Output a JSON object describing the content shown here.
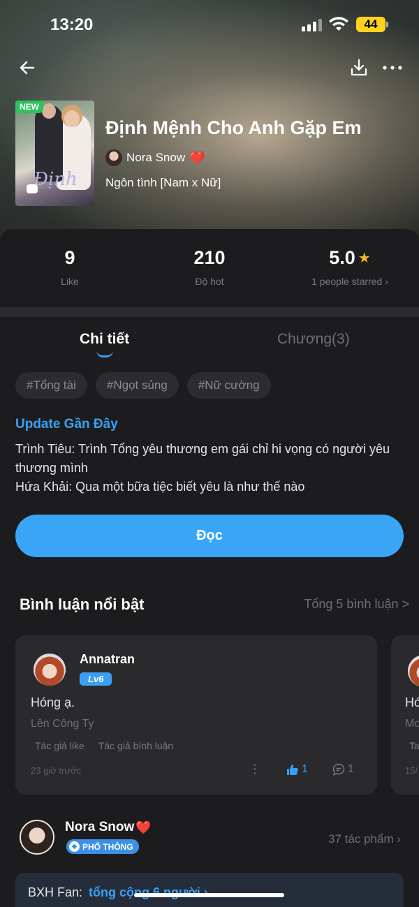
{
  "status": {
    "time": "13:20",
    "battery": "44"
  },
  "book": {
    "badge": "NEW",
    "cover_art_text": "Định",
    "title": "Định Mệnh Cho Anh Gặp Em",
    "author": "Nora Snow",
    "author_suffix": "❤️",
    "genre": "Ngôn tình [Nam x Nữ]"
  },
  "stats": {
    "likes": {
      "value": "9",
      "label": "Like"
    },
    "hot": {
      "value": "210",
      "label": "Độ hot"
    },
    "rating": {
      "value": "5.0",
      "label": "1 people starred ›"
    }
  },
  "tabs": {
    "detail": "Chi tiết",
    "chapters": "Chương(3)"
  },
  "tags": [
    "#Tổng tài",
    "#Ngọt sủng",
    "#Nữ cường"
  ],
  "update": {
    "title": "Update Gần Đây",
    "line1": "Trình Tiêu: Trình Tổng yêu thương em gái chỉ hi vọng có người yêu thương mình",
    "line2": "Hứa Khải: Qua một bữa tiệc biết yêu là như thế nào"
  },
  "read_button": "Đọc",
  "comments": {
    "title": "Bình luận nổi bật",
    "total": "Tổng 5 bình luận >",
    "items": [
      {
        "user": "Annatran",
        "level": "Lv6",
        "text": "Hóng ạ.",
        "chapter": "Lên Công Ty",
        "chip_like": "Tác giả like",
        "chip_comment": "Tác giả bình luận",
        "time": "23 giờ trước",
        "likes": "1",
        "replies": "1"
      }
    ],
    "peek": {
      "t1": "Hó",
      "t2": "Mo",
      "t3": "Ta",
      "t4": "15/"
    }
  },
  "author_block": {
    "name": "Nora Snow",
    "heart": "❤️",
    "badge": "PHỔ THÔNG",
    "works": "37 tác phẩm ›"
  },
  "fan": {
    "label": "BXH Fan:",
    "link": "tổng cộng 6 người ›"
  },
  "colors": {
    "accent": "#3aa0f5",
    "background": "#1c1c1e",
    "star": "#ffb52e"
  }
}
